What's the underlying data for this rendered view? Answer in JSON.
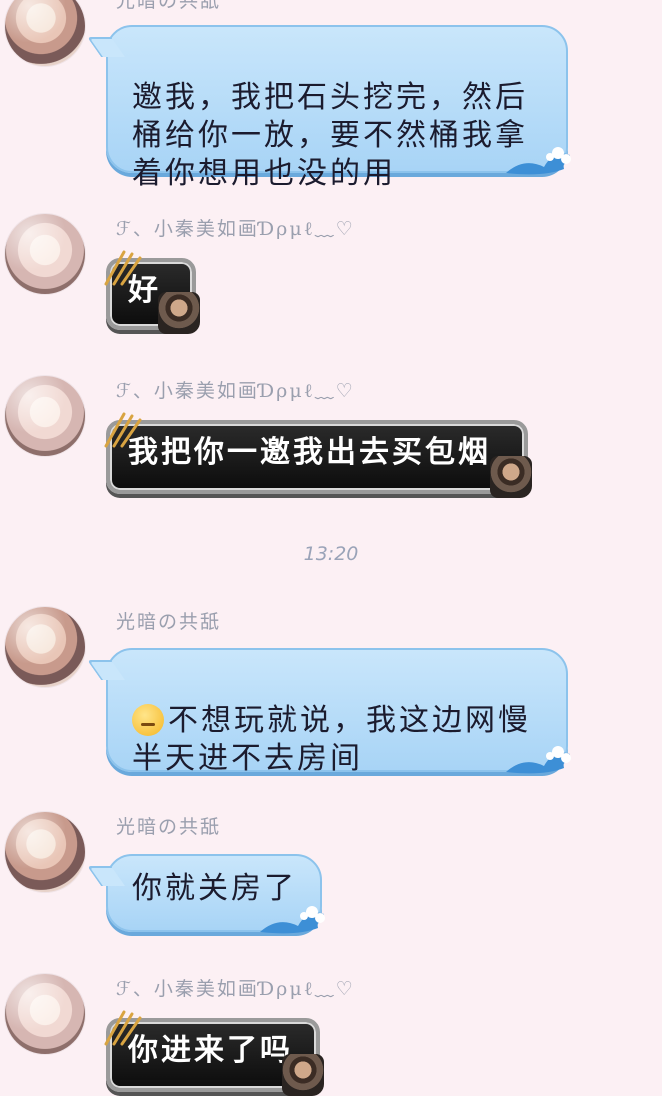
{
  "messages": [
    {
      "sender": "光暗の共舐",
      "type": "blue",
      "text": "邀我，我把石头挖完，然后\n桶给你一放，要不然桶我拿\n着你想用也没的用"
    },
    {
      "sender": "ℱ、小秦美如画Ɗρμℓ﹏♡",
      "type": "dark",
      "text": "好"
    },
    {
      "sender": "ℱ、小秦美如画Ɗρμℓ﹏♡",
      "type": "dark",
      "text": "我把你一邀我出去买包烟"
    },
    {
      "sender": "光暗の共舐",
      "type": "blue",
      "text": "不想玩就说，我这边网慢\n半天进不去房间",
      "emoji": "thinking-face"
    },
    {
      "sender": "光暗の共舐",
      "type": "blue",
      "text": "你就关房了"
    },
    {
      "sender": "ℱ、小秦美如画Ɗρμℓ﹏♡",
      "type": "dark",
      "text": "你进来了吗"
    }
  ],
  "timestamp": "13:20"
}
